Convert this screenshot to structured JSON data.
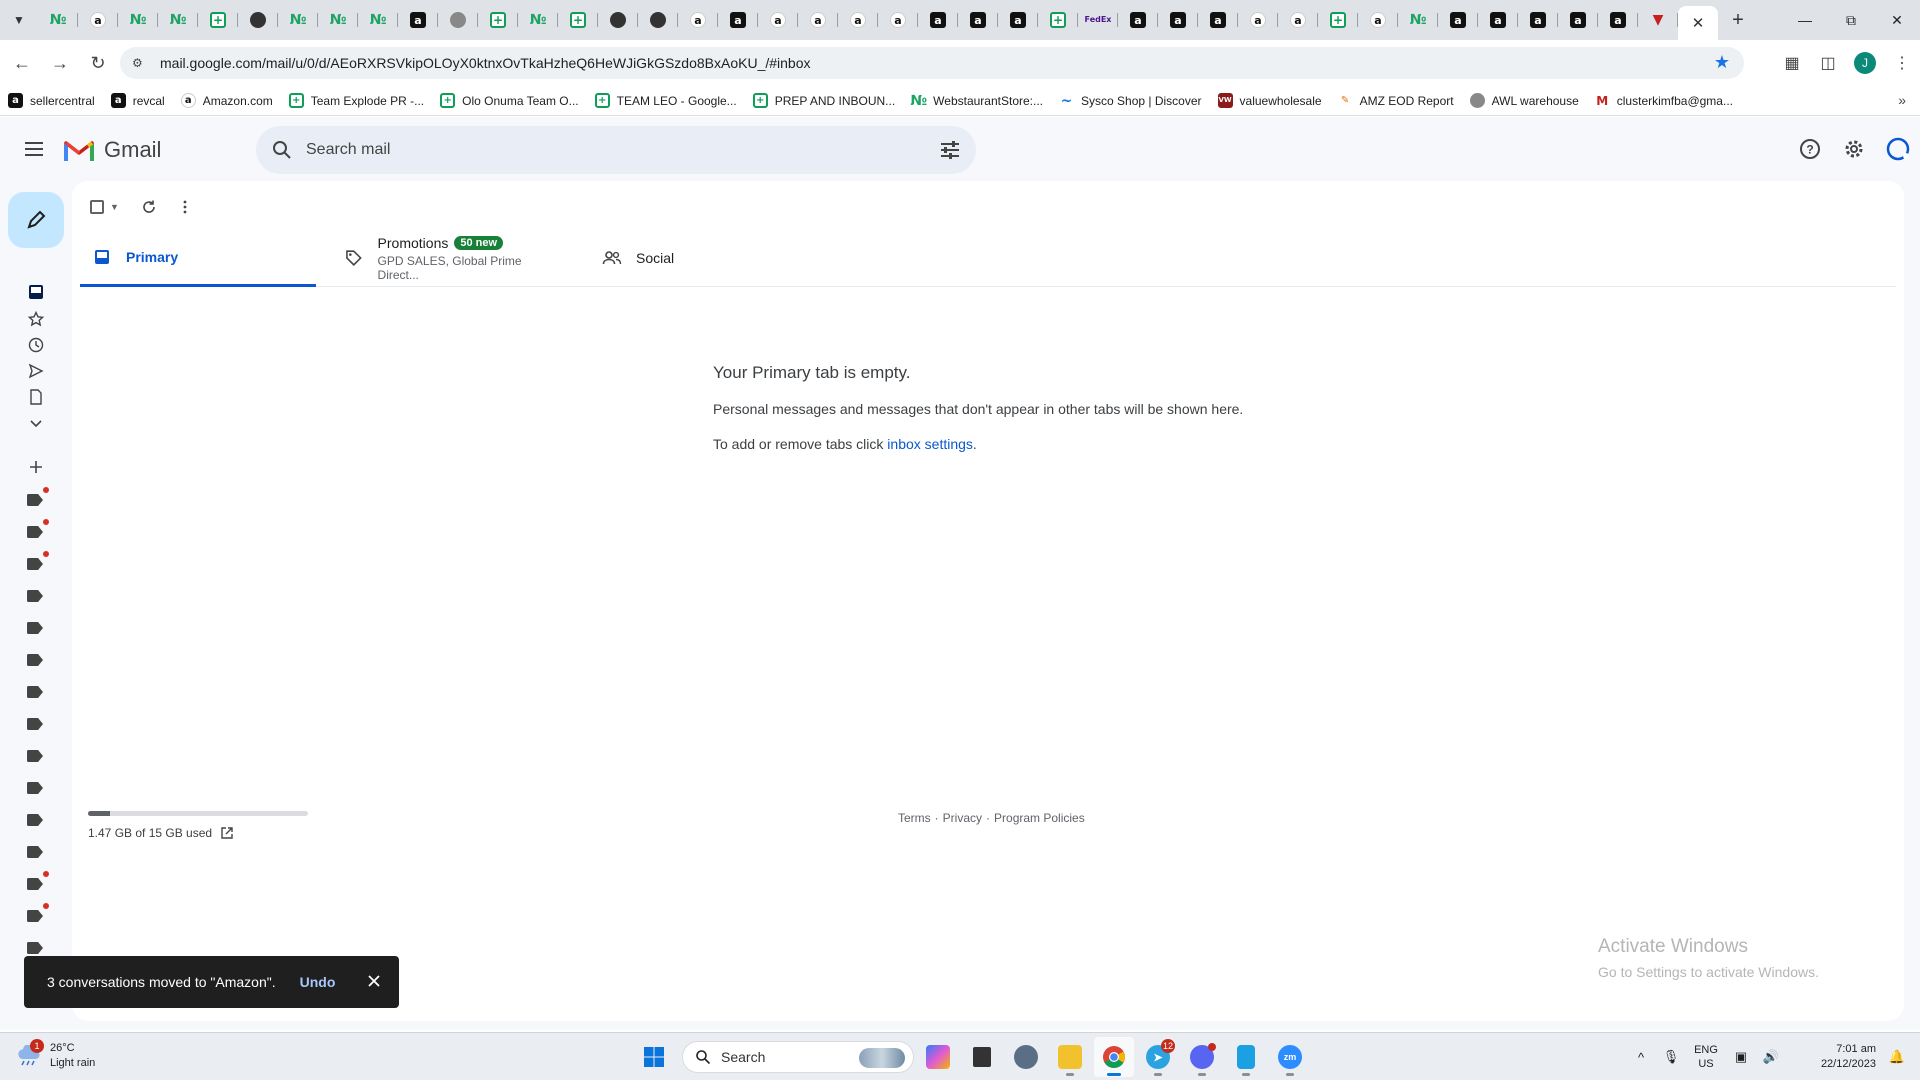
{
  "browser": {
    "tab_favicons": [
      "gd",
      "amz-white",
      "gd",
      "gd",
      "sheets",
      "dark",
      "gd",
      "gd",
      "gd",
      "amz-black",
      "grey",
      "sheets",
      "gd",
      "sheets",
      "dark",
      "dark",
      "amz-white",
      "amz-black",
      "amz-white",
      "amz-white",
      "amz-white",
      "amz-white",
      "amz-black",
      "amz-black",
      "amz-black",
      "sheets",
      "fedex",
      "amz-black",
      "amz-black",
      "amz-black",
      "amz-white",
      "amz-white",
      "sheets",
      "amz-white",
      "gd",
      "amz-black",
      "amz-black",
      "amz-black",
      "amz-black",
      "amz-black",
      "red"
    ],
    "url": "mail.google.com/mail/u/0/d/AEoRXRSVkipOLOyX0ktnxOvTkaHzheQ6HeWJiGkGSzdo8BxAoKU_/#inbox",
    "profile_initial": "J",
    "bookmarks": [
      {
        "label": "sellercentral",
        "icon": "amz-black"
      },
      {
        "label": "revcal",
        "icon": "amz-black"
      },
      {
        "label": "Amazon.com",
        "icon": "amz-white"
      },
      {
        "label": "Team Explode PR -...",
        "icon": "sheets"
      },
      {
        "label": "Olo Onuma Team O...",
        "icon": "sheets"
      },
      {
        "label": "TEAM LEO - Google...",
        "icon": "sheets"
      },
      {
        "label": "PREP AND INBOUN...",
        "icon": "sheets"
      },
      {
        "label": "WebstaurantStore:...",
        "icon": "gd"
      },
      {
        "label": "Sysco Shop | Discover",
        "icon": "sysco"
      },
      {
        "label": "valuewholesale",
        "icon": "vw"
      },
      {
        "label": "AMZ EOD Report",
        "icon": "eod"
      },
      {
        "label": "AWL warehouse",
        "icon": "grey"
      },
      {
        "label": "clusterkimfba@gma...",
        "icon": "gmail"
      }
    ]
  },
  "gmail": {
    "brand": "Gmail",
    "search_placeholder": "Search mail",
    "tabs": {
      "primary": "Primary",
      "promotions": "Promotions",
      "promotions_badge": "50 new",
      "promotions_senders": "GPD SALES, Global Prime Direct...",
      "social": "Social"
    },
    "empty_state": {
      "title": "Your Primary tab is empty.",
      "line1": "Personal messages and messages that don't appear in other tabs will be shown here.",
      "line2_prefix": "To add or remove tabs click ",
      "line2_link": "inbox settings",
      "line2_suffix": "."
    },
    "storage": {
      "text": "1.47 GB of 15 GB used",
      "used_fraction": 0.098
    },
    "footer": {
      "terms": "Terms",
      "privacy": "Privacy",
      "policies": "Program Policies",
      "separator": "·"
    },
    "label_dots": [
      true,
      true,
      true,
      false,
      false,
      false,
      false,
      false,
      false,
      false,
      false,
      false,
      true,
      true,
      false
    ]
  },
  "snackbar": {
    "message": "3 conversations moved to \"Amazon\".",
    "action": "Undo"
  },
  "watermark": {
    "line1": "Activate Windows",
    "line2": "Go to Settings to activate Windows."
  },
  "taskbar": {
    "weather_temp": "26°C",
    "weather_desc": "Light rain",
    "weather_badge": "1",
    "search_label": "Search",
    "telegram_badge": "12",
    "lang_line1": "ENG",
    "lang_line2": "US",
    "time": "7:01 am",
    "date": "22/12/2023"
  },
  "colors": {
    "accent": "#0b57d0",
    "promo_badge": "#188038",
    "compose": "#c2e7ff"
  }
}
